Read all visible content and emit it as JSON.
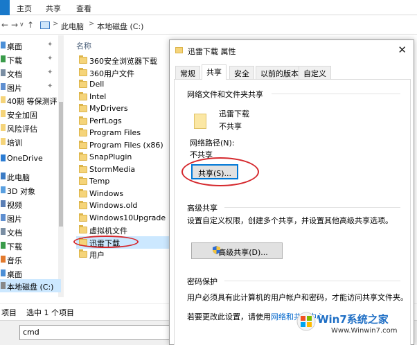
{
  "ribbon": {
    "file": "",
    "home": "主页",
    "share": "共享",
    "view": "查看"
  },
  "address": {
    "back": "←",
    "forward": "→",
    "up": "↑",
    "dropdown": "∨",
    "crumb1": "此电脑",
    "crumb2": "本地磁盘 (C:)",
    "separator": ">",
    "refresh": "↻"
  },
  "nav": {
    "items": [
      {
        "label": "桌面",
        "pin": "✦"
      },
      {
        "label": "下载",
        "pin": "✦"
      },
      {
        "label": "文档",
        "pin": "✦"
      },
      {
        "label": "图片",
        "pin": "✦"
      },
      {
        "label": "40期 等保测评"
      },
      {
        "label": "安全加固"
      },
      {
        "label": "风险评估"
      },
      {
        "label": "培训"
      },
      {
        "label": "OneDrive"
      },
      {
        "label": "此电脑"
      },
      {
        "label": "3D 对象"
      },
      {
        "label": "视频"
      },
      {
        "label": "图片"
      },
      {
        "label": "文档"
      },
      {
        "label": "下载"
      },
      {
        "label": "音乐"
      },
      {
        "label": "桌面"
      },
      {
        "label": "本地磁盘 (C:)"
      }
    ]
  },
  "list": {
    "column_name": "名称",
    "files": [
      "360安全浏览器下载",
      "360用户文件",
      "Dell",
      "Intel",
      "MyDrivers",
      "PerfLogs",
      "Program Files",
      "Program Files (x86)",
      "SnapPlugin",
      "StormMedia",
      "Temp",
      "Windows",
      "Windows.old",
      "Windows10Upgrade",
      "虚拟机文件",
      "迅雷下载",
      "用户"
    ],
    "selected_index": 15
  },
  "status": {
    "count": "项目",
    "selected": "选中 1 个项目"
  },
  "cmd": {
    "value": "cmd"
  },
  "dialog": {
    "title": "迅雷下载 属性",
    "close": "✕",
    "tabs": [
      "常规",
      "共享",
      "安全",
      "以前的版本",
      "自定义"
    ],
    "active_tab": "共享",
    "network_group": "网络文件和文件夹共享",
    "folder_name": "迅雷下载",
    "folder_state": "不共享",
    "path_label": "网络路径(N):",
    "path_value": "不共享",
    "share_button": "共享(S)...",
    "advanced_group": "高级共享",
    "advanced_desc": "设置自定义权限，创建多个共享，并设置其他高级共享选项。",
    "advanced_button": "高级共享(D)...",
    "password_group": "密码保护",
    "password_desc": "用户必须具有此计算机的用户帐户和密码，才能访问共享文件夹。",
    "password_change_prefix": "若要更改此设置，请使用",
    "password_link": "网络和共享中心"
  },
  "watermark": {
    "brand": "Win7系统之家",
    "url": "Www.Winwin7.com"
  },
  "colors": {
    "accent": "#0078d7",
    "selection": "#cce8ff",
    "annotation": "#d5282d",
    "folder": "#f5d47a"
  }
}
